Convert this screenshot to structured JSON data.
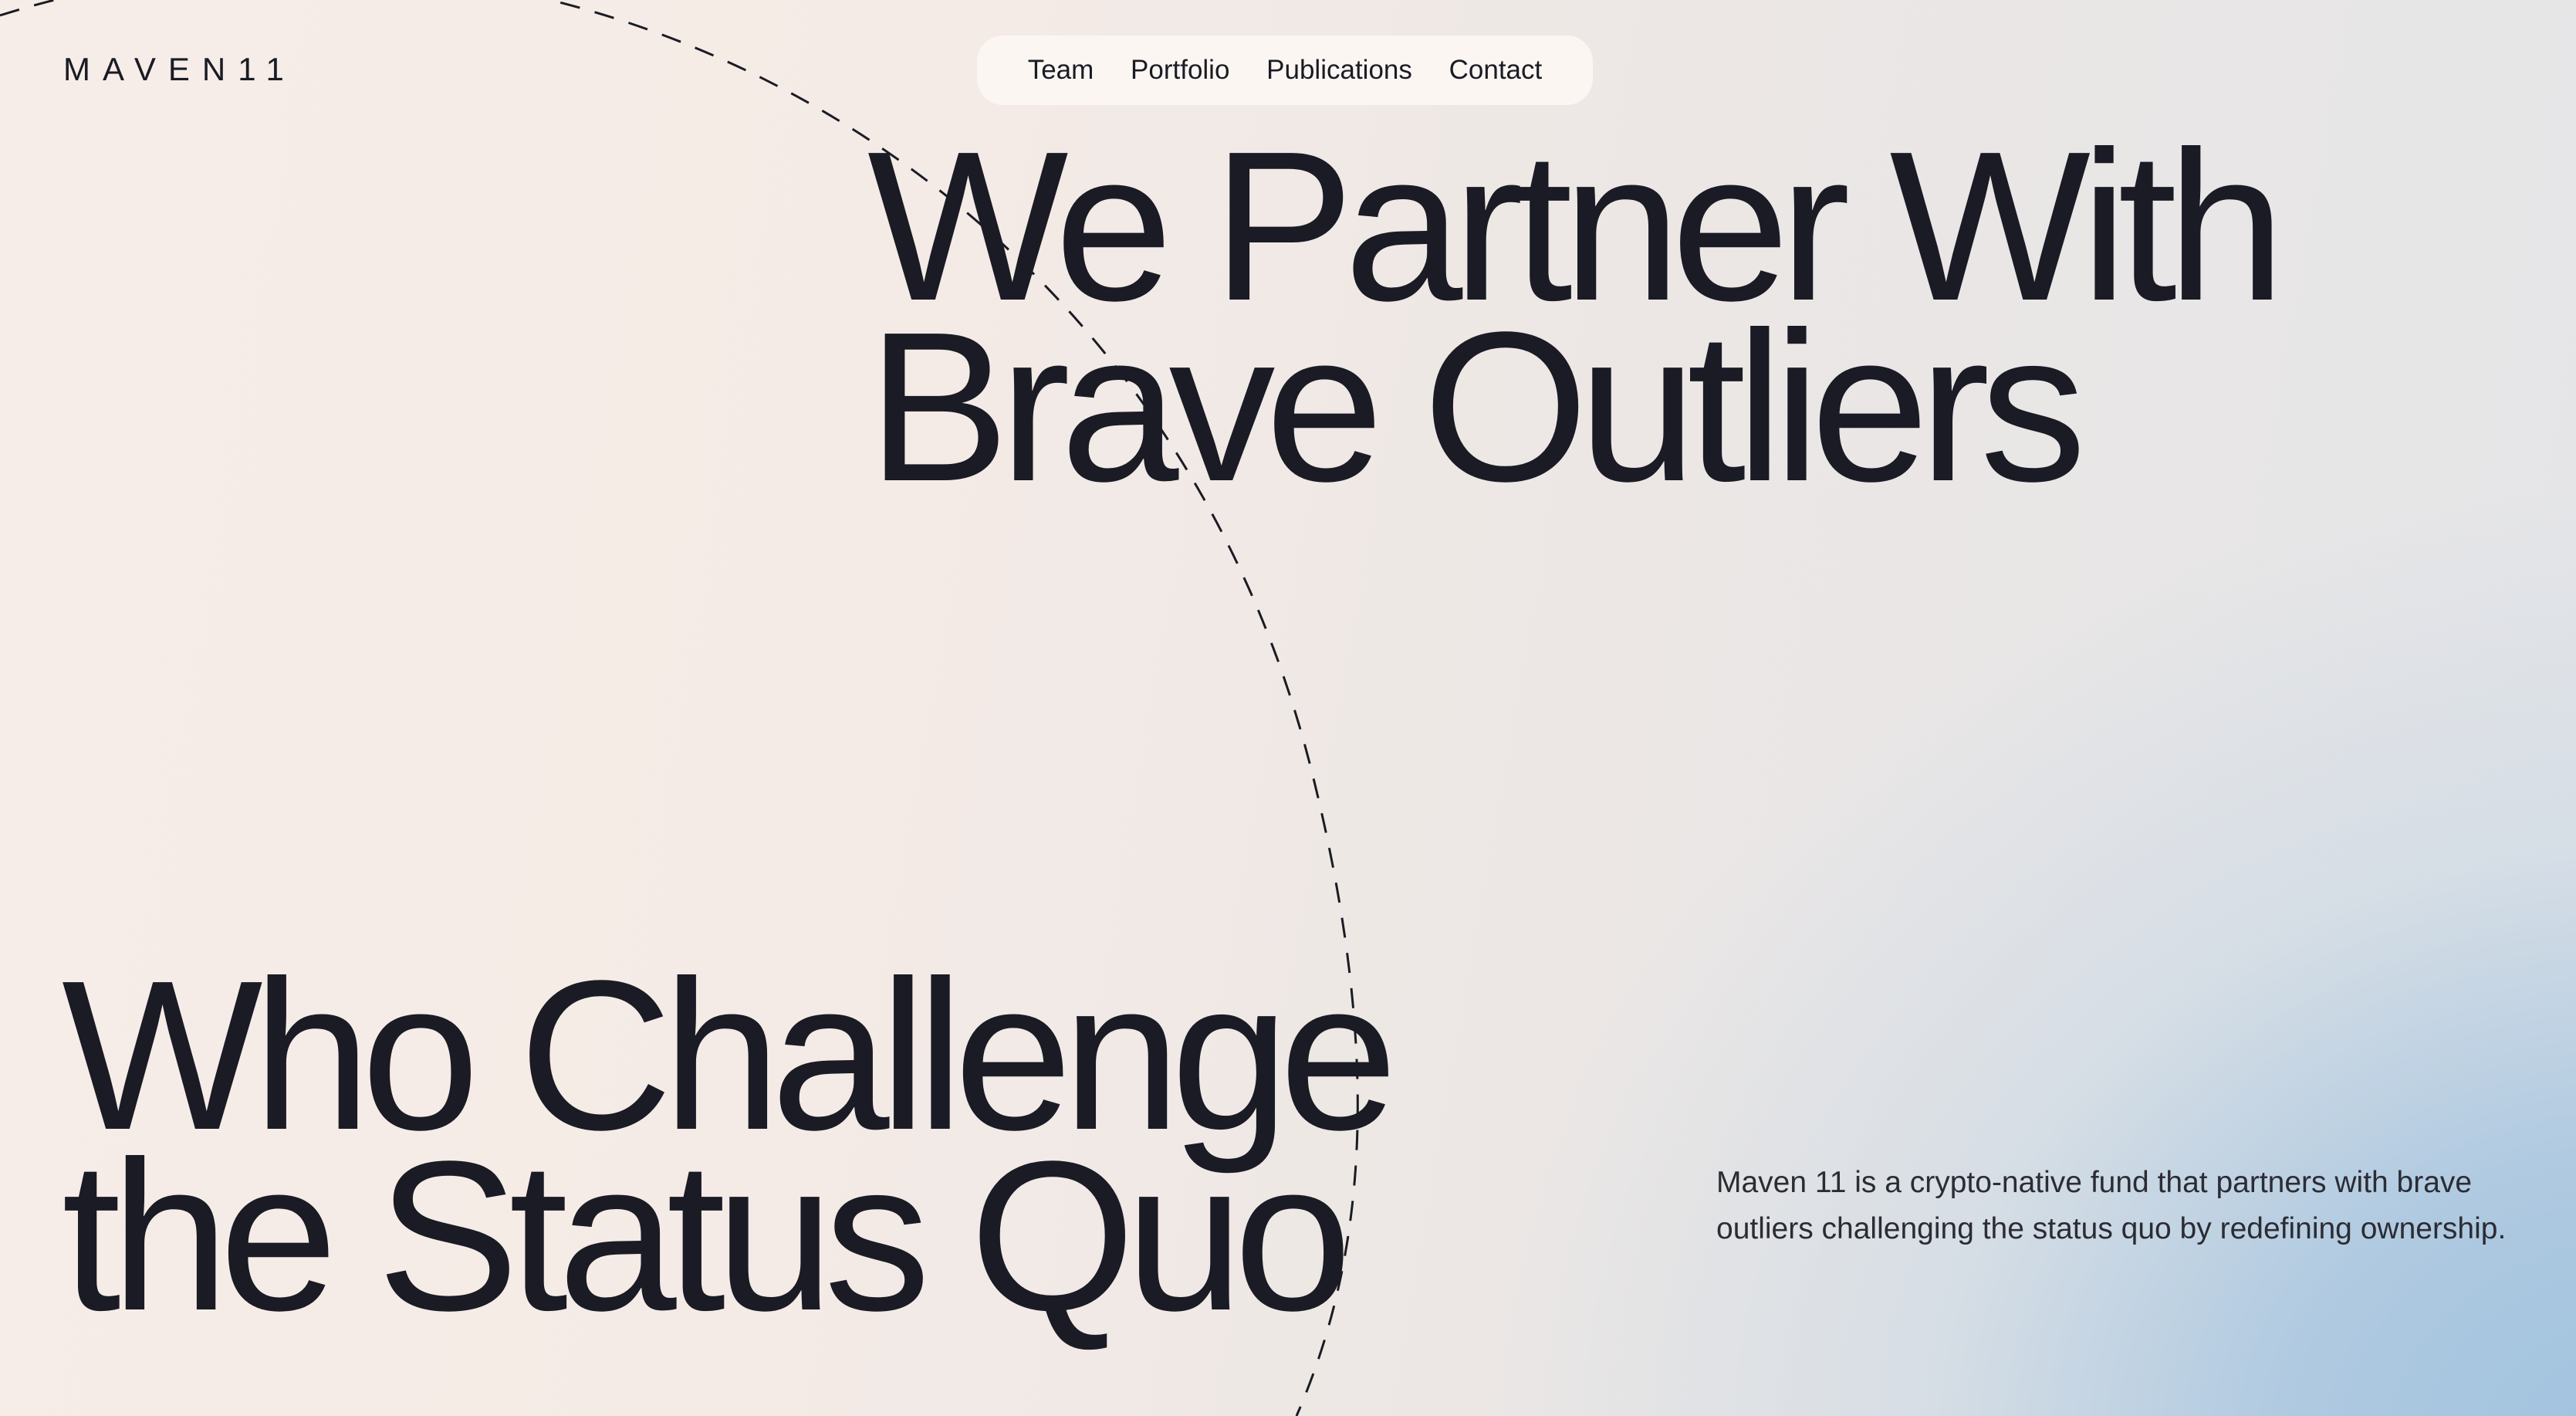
{
  "brand": {
    "logo_text": "MAVEN11"
  },
  "nav": {
    "items": [
      {
        "label": "Team"
      },
      {
        "label": "Portfolio"
      },
      {
        "label": "Publications"
      },
      {
        "label": "Contact"
      }
    ]
  },
  "hero": {
    "headline_top": [
      "We Partner With",
      "Brave Outliers"
    ],
    "headline_bottom": [
      "Who Challenge",
      "the Status Quo"
    ],
    "description": "Maven 11 is a crypto-native fund that partners with brave outliers challenging the status quo by redefining ownership."
  },
  "colors": {
    "text": "#1a1b24",
    "background_warm": "#f6ece7",
    "background_blue": "#a8c3dd",
    "nav_background": "#fbf6f2"
  }
}
